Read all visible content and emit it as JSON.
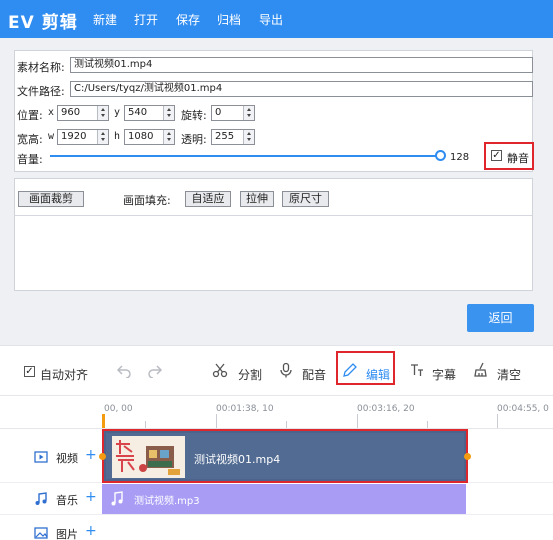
{
  "app": {
    "logo": "EV 剪辑",
    "menu": [
      "新建",
      "打开",
      "保存",
      "归档",
      "导出"
    ]
  },
  "props": {
    "name_label": "素材名称:",
    "name_value": "测试视频01.mp4",
    "path_label": "文件路径:",
    "path_value": "C:/Users/tyqz/测试视频01.mp4",
    "pos_label": "位置:",
    "x_label": "x",
    "x_value": "960",
    "y_label": "y",
    "y_value": "540",
    "rotate_label": "旋转:",
    "rotate_value": "0",
    "size_label": "宽高:",
    "w_label": "w",
    "w_value": "1920",
    "h_label": "h",
    "h_value": "1080",
    "opacity_label": "透明:",
    "opacity_value": "255",
    "volume_label": "音量:",
    "volume_value": "128",
    "volume_level": 1.0,
    "mute_label": "静音",
    "mute_checked": true
  },
  "crop": {
    "crop_button": "画面裁剪",
    "fill_label": "画面填充:",
    "fill_options": [
      "自适应",
      "拉伸",
      "原尺寸"
    ]
  },
  "back_button": "返回",
  "toolbar": {
    "auto_align": "自动对齐",
    "split": "分割",
    "dub": "配音",
    "edit": "编辑",
    "subtitle": "字幕",
    "clear": "清空"
  },
  "timeline": {
    "ruler": [
      "00, 00",
      "00:01:38, 10",
      "00:03:16, 20",
      "00:04:55, 0"
    ],
    "tracks": [
      {
        "label": "视频",
        "add": "+"
      },
      {
        "label": "音乐",
        "add": "+"
      },
      {
        "label": "图片",
        "add": "+"
      }
    ],
    "video_clip": "测试视频01.mp4",
    "music_clip": "测试视频.mp3"
  },
  "colors": {
    "accent": "#2f8cf0",
    "highlight": "#e0262d",
    "video_clip": "#516b92",
    "music_clip": "#a89cf5",
    "playhead": "#f39c12"
  }
}
